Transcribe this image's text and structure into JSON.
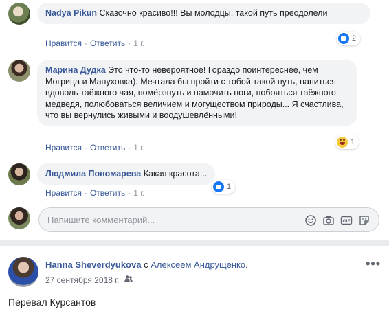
{
  "comments": [
    {
      "author": "Nadya Pikun",
      "text": "Сказочно красиво!!! Вы молодцы, такой путь преодолели",
      "like": "Нравится",
      "reply": "Ответить",
      "time": "1 г.",
      "reaction": "like",
      "reaction_count": "2"
    },
    {
      "author": "Марина Дудка",
      "text": "Это что-то невероятное! Гораздо поинтереснее, чем Могрица и Мануховка). Мечтала бы пройти с тобой такой путь, напиться вдоволь таёжного чая, помёрзнуть и намочить ноги, побояться таёжного медведя, полюбоваться величием и могуществом природы... Я счастлива, что вы вернулись живыми и воодушевлёнными!",
      "like": "Нравится",
      "reply": "Ответить",
      "time": "1 г.",
      "reaction": "haha",
      "reaction_count": "1"
    },
    {
      "author": "Людмила Пономарева",
      "text": "Какая красота...",
      "like": "Нравится",
      "reply": "Ответить",
      "time": "1 г.",
      "reaction": "like",
      "reaction_count": "1"
    }
  ],
  "composer": {
    "placeholder": "Напишите комментарий...",
    "tools": [
      "emoji-icon",
      "camera-icon",
      "gif-icon",
      "sticker-icon"
    ],
    "gif_label": "GIF"
  },
  "post": {
    "author": "Hanna Sheverdyukova",
    "with_prefix": "с",
    "with_name": "Алексеем Андрущенко",
    "with_suffix": ".",
    "date": "27 сентября 2018 г.",
    "privacy_icon": "friends-icon",
    "more_icon": "more-icon",
    "more_text": "•••",
    "text": "Перевал Курсантов"
  },
  "colors": {
    "link": "#385898",
    "bubble": "#f2f3f5",
    "divider": "#e9ebee",
    "like_blue": "#1877f2"
  }
}
